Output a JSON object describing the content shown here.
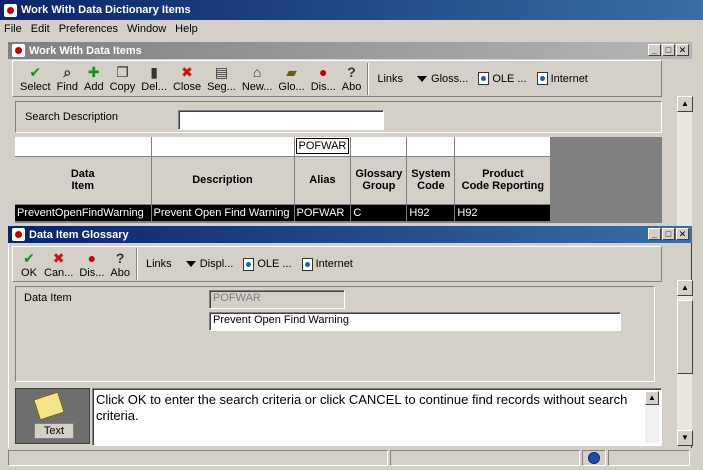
{
  "app": {
    "title": "Work With Data Dictionary Items"
  },
  "menu": [
    "File",
    "Edit",
    "Preferences",
    "Window",
    "Help"
  ],
  "child1": {
    "title": "Work With Data Items",
    "toolbar": [
      {
        "name": "select",
        "label": "Select",
        "icon": "check-icon",
        "color": "#1a8f1a",
        "glyph": "✔"
      },
      {
        "name": "find",
        "label": "Find",
        "icon": "find-icon",
        "color": "#333333",
        "glyph": "⌕"
      },
      {
        "name": "add",
        "label": "Add",
        "icon": "add-icon",
        "color": "#1a8f1a",
        "glyph": "✚"
      },
      {
        "name": "copy",
        "label": "Copy",
        "icon": "copy-icon",
        "color": "#333333",
        "glyph": "❐"
      },
      {
        "name": "delete",
        "label": "Del...",
        "icon": "trash-icon",
        "color": "#333333",
        "glyph": "▮"
      },
      {
        "name": "close",
        "label": "Close",
        "icon": "close-icon",
        "color": "#d01010",
        "glyph": "✖"
      },
      {
        "name": "sequence",
        "label": "Seg...",
        "icon": "sequence-icon",
        "color": "#333333",
        "glyph": "▤"
      },
      {
        "name": "new",
        "label": "New...",
        "icon": "new-icon",
        "color": "#333333",
        "glyph": "⌂"
      },
      {
        "name": "glossary",
        "label": "Glo...",
        "icon": "book-icon",
        "color": "#6b5a12",
        "glyph": "▰"
      },
      {
        "name": "display",
        "label": "Dis...",
        "icon": "display-icon",
        "color": "#c00000",
        "glyph": "●"
      },
      {
        "name": "about",
        "label": "Abo",
        "icon": "about-icon",
        "color": "#333333",
        "glyph": "?"
      }
    ],
    "links": {
      "label": "Links",
      "gloss": "Gloss...",
      "ole": "OLE ...",
      "internet": "Internet"
    },
    "search": {
      "label": "Search Description",
      "value": ""
    },
    "grid": {
      "qbe": [
        "",
        "",
        "POFWAR",
        "",
        "",
        ""
      ],
      "headers": [
        [
          "Data",
          "Item"
        ],
        [
          "Description"
        ],
        [
          "Alias"
        ],
        [
          "Glossary",
          "Group"
        ],
        [
          "System",
          "Code"
        ],
        [
          "Product",
          "Code Reporting"
        ]
      ],
      "rows": [
        [
          "PreventOpenFindWarning",
          "Prevent Open Find Warning",
          "POFWAR",
          "C",
          "H92",
          "H92"
        ]
      ]
    }
  },
  "child2": {
    "title": "Data Item Glossary",
    "toolbar": [
      {
        "name": "ok",
        "label": "OK",
        "icon": "check-icon",
        "color": "#1a8f1a",
        "glyph": "✔"
      },
      {
        "name": "cancel",
        "label": "Can...",
        "icon": "close-icon",
        "color": "#d01010",
        "glyph": "✖"
      },
      {
        "name": "display",
        "label": "Dis...",
        "icon": "display-icon",
        "color": "#c00000",
        "glyph": "●"
      },
      {
        "name": "about",
        "label": "Abo",
        "icon": "about-icon",
        "color": "#333333",
        "glyph": "?"
      }
    ],
    "links": {
      "label": "Links",
      "display": "Displ...",
      "ole": "OLE ...",
      "internet": "Internet"
    },
    "form": {
      "data_item_label": "Data Item",
      "alias_value": "POFWAR",
      "description_value": "Prevent Open Find Warning"
    },
    "text_button": "Text",
    "glossary_text": "Click OK to enter the search criteria or click CANCEL to continue find records without search criteria."
  }
}
